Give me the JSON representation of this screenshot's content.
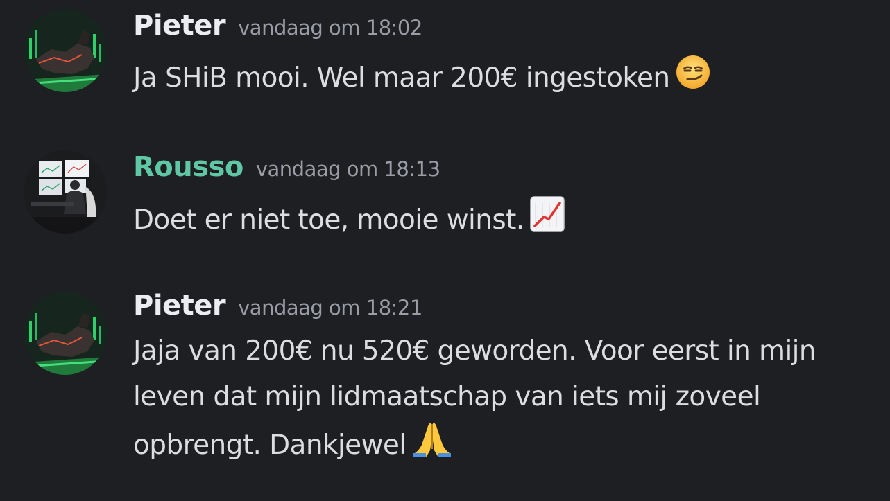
{
  "messages": [
    {
      "author": "Pieter",
      "author_color": "#ebedf2",
      "timestamp": "vandaag om 18:02",
      "text": "Ja SHiB mooi. Wel maar 200€ ingestoken",
      "emoji": "smirk-face-icon"
    },
    {
      "author": "Rousso",
      "author_color": "#5fc7a4",
      "timestamp": "vandaag om 18:13",
      "text": "Doet er niet toe, mooie winst.",
      "emoji": "chart-increasing-icon"
    },
    {
      "author": "Pieter",
      "author_color": "#ebedf2",
      "timestamp": "vandaag om 18:21",
      "text": "Jaja van 200€ nu 520€ geworden. Voor eerst in mijn leven dat mijn lidmaatschap van iets mij zoveel opbrengt. Dankjewel",
      "emoji": "folded-hands-icon"
    }
  ],
  "colors": {
    "background": "#1e1f23",
    "message_text": "#dcdde1",
    "timestamp": "#9a9ca6"
  }
}
